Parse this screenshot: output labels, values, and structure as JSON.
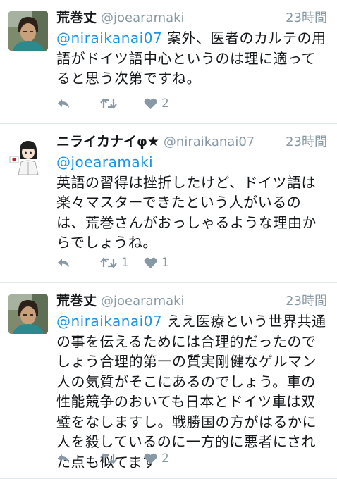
{
  "tweets": [
    {
      "name": "荒巻丈",
      "handle": "@joearamaki",
      "time": "23時間",
      "mention": "@niraikanai07",
      "body": " 案外、医者のカルテの用語がドイツ語中心というのは理に適ってると思う次第ですね。",
      "retweets": "",
      "likes": "2"
    },
    {
      "name": "ニライカナイφ★",
      "handle": "@niraikanai07",
      "time": "23時間",
      "mention": "@joearamaki",
      "body": "英語の習得は挫折したけど、ドイツ語は楽々マスターできたという人がいるのは、荒巻さんがおっしゃるような理由からでしょうね。",
      "retweets": "1",
      "likes": "1"
    },
    {
      "name": "荒巻丈",
      "handle": "@joearamaki",
      "time": "23時間",
      "mention": "@niraikanai07",
      "body": " ええ医療という世界共通の事を伝えるためには合理的だったのでしょう合理的第一の質実剛健なゲルマン人の気質がそこにあるのでしょう。車の性能競争のおいても日本とドイツ車は双璧をなしますし。戦勝国の方がはるかに人を殺しているのに一方的に悪者にされた点も似てます",
      "retweets": "",
      "likes": "2"
    }
  ],
  "icons": {
    "reply": "reply-icon",
    "retweet": "retweet-icon",
    "like": "heart-icon"
  },
  "colors": {
    "link": "#1b95e0",
    "muted": "#8899a6",
    "divider": "#e1e8ed"
  }
}
